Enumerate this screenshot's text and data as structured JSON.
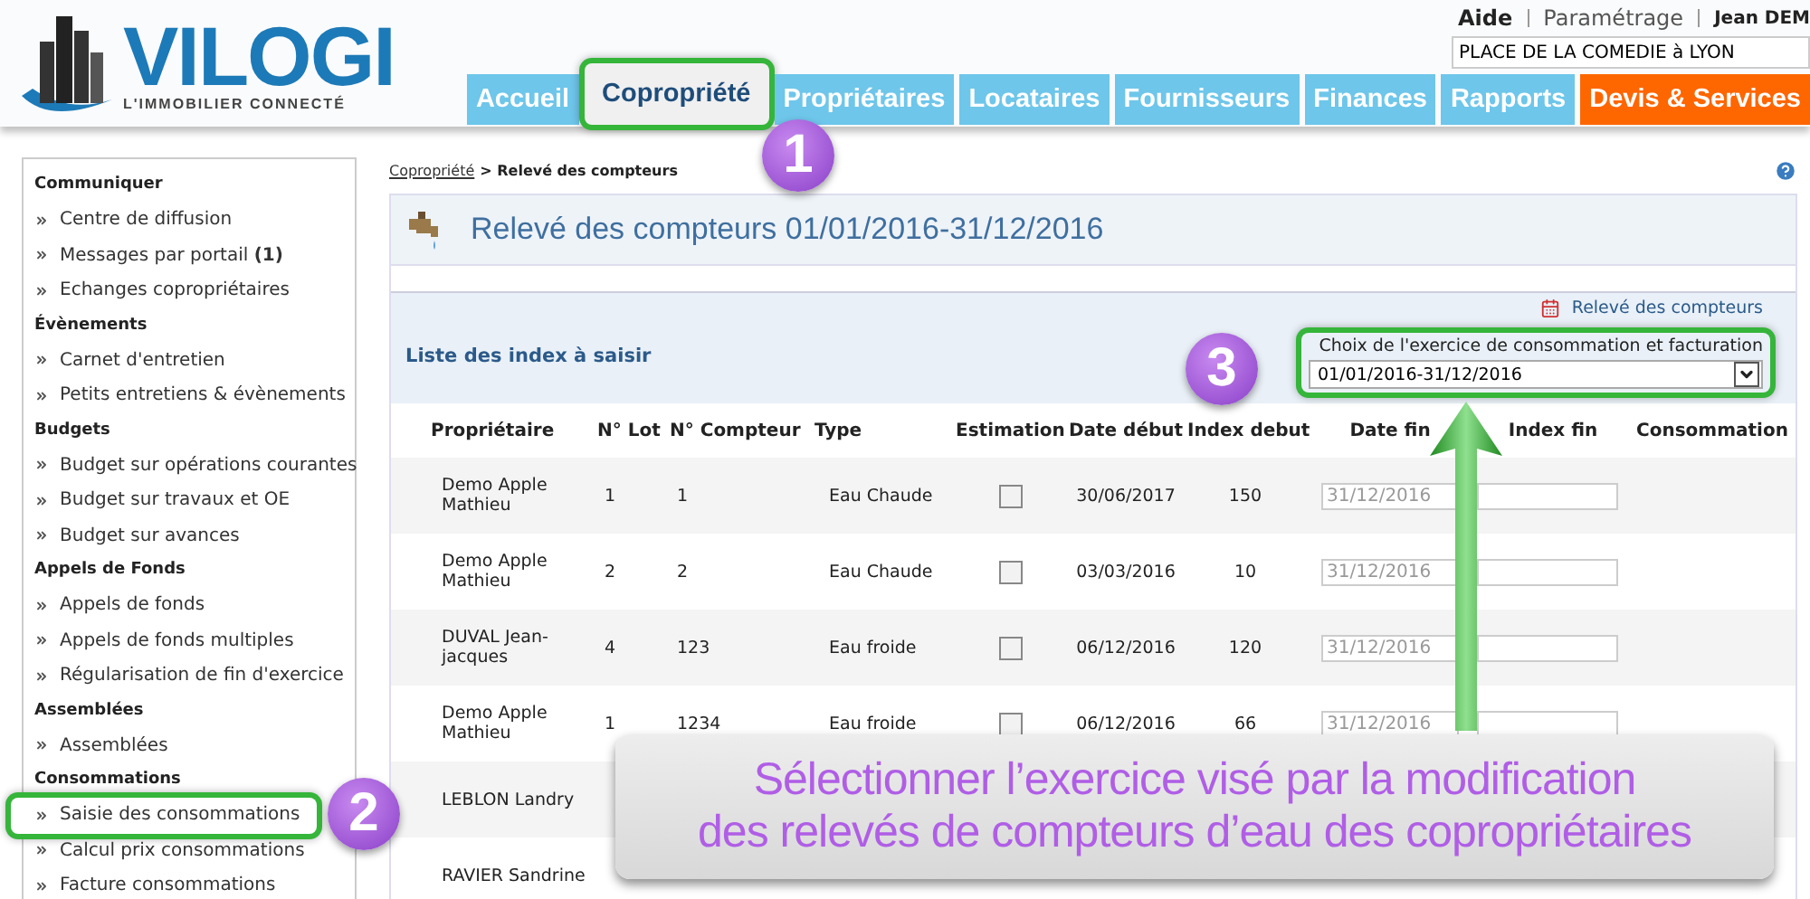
{
  "header": {
    "logo": {
      "name": "VILOGI",
      "tagline": "L'IMMOBILIER CONNECTÉ"
    },
    "top_links": [
      "Aide",
      "Paramétrage",
      "Jean DEM"
    ],
    "location_field": {
      "value": "PLACE DE LA COMEDIE à LYON"
    },
    "nav_tabs": [
      {
        "label": "Accueil",
        "selected": false,
        "highlighted": false,
        "kind": "normal"
      },
      {
        "label": "Copropriété",
        "selected": true,
        "highlighted": true,
        "kind": "normal"
      },
      {
        "label": "Propriétaires",
        "selected": false,
        "highlighted": false,
        "kind": "normal"
      },
      {
        "label": "Locataires",
        "selected": false,
        "highlighted": false,
        "kind": "normal"
      },
      {
        "label": "Fournisseurs",
        "selected": false,
        "highlighted": false,
        "kind": "normal"
      },
      {
        "label": "Finances",
        "selected": false,
        "highlighted": false,
        "kind": "normal"
      },
      {
        "label": "Rapports",
        "selected": false,
        "highlighted": false,
        "kind": "normal"
      },
      {
        "label": "Devis & Services",
        "selected": false,
        "highlighted": false,
        "kind": "accent"
      }
    ]
  },
  "sidebar": {
    "sections": [
      {
        "title": "Communiquer",
        "items": [
          {
            "label": "Centre de diffusion",
            "highlighted": false
          },
          {
            "label": "Messages par portail **(1)**",
            "highlighted": false
          },
          {
            "label": "Echanges copropriétaires",
            "highlighted": false
          }
        ]
      },
      {
        "title": "Évènements",
        "items": [
          {
            "label": "Carnet d'entretien",
            "highlighted": false
          },
          {
            "label": "Petits entretiens & évènements",
            "highlighted": false
          }
        ]
      },
      {
        "title": "Budgets",
        "items": [
          {
            "label": "Budget sur opérations courantes",
            "highlighted": false
          },
          {
            "label": "Budget sur travaux et OE",
            "highlighted": false
          },
          {
            "label": "Budget sur avances",
            "highlighted": false
          }
        ]
      },
      {
        "title": "Appels de Fonds",
        "items": [
          {
            "label": "Appels de fonds",
            "highlighted": false
          },
          {
            "label": "Appels de fonds multiples",
            "highlighted": false
          },
          {
            "label": "Régularisation de fin d'exercice",
            "highlighted": false
          }
        ]
      },
      {
        "title": "Assemblées",
        "items": [
          {
            "label": "Assemblées",
            "highlighted": false
          }
        ]
      },
      {
        "title": "Consommations",
        "items": [
          {
            "label": "Saisie des consommations",
            "highlighted": true
          },
          {
            "label": "Calcul prix consommations",
            "highlighted": false
          },
          {
            "label": "Facture consommations",
            "highlighted": false
          }
        ]
      }
    ]
  },
  "breadcrumb": {
    "link": "Copropriété",
    "current": "> Relevé des compteurs"
  },
  "page_title": "Relevé des compteurs 01/01/2016-31/12/2016",
  "panel": {
    "link": "Relevé des compteurs",
    "title": "Liste des index à saisir",
    "exercise_select": {
      "label": "Choix de l'exercice de consommation et facturation",
      "value": "01/01/2016-31/12/2016",
      "highlighted": true
    }
  },
  "table": {
    "columns": [
      "Propriétaire",
      "N° Lot",
      "N° Compteur",
      "Type",
      "Estimation",
      "Date début",
      "Index debut",
      "Date fin",
      "Index fin",
      "Consommation"
    ],
    "rows": [
      {
        "owner": "Demo Apple Mathieu",
        "lot": "1",
        "meter": "1",
        "type": "Eau Chaude",
        "estimation": false,
        "start_date": "30/06/2017",
        "start_index": "150",
        "end_date": "31/12/2016"
      },
      {
        "owner": "Demo Apple Mathieu",
        "lot": "2",
        "meter": "2",
        "type": "Eau Chaude",
        "estimation": false,
        "start_date": "03/03/2016",
        "start_index": "10",
        "end_date": "31/12/2016"
      },
      {
        "owner": "DUVAL Jean-jacques",
        "lot": "4",
        "meter": "123",
        "type": "Eau froide",
        "estimation": false,
        "start_date": "06/12/2016",
        "start_index": "120",
        "end_date": "31/12/2016"
      },
      {
        "owner": "Demo Apple Mathieu",
        "lot": "1",
        "meter": "1234",
        "type": "Eau froide",
        "estimation": false,
        "start_date": "06/12/2016",
        "start_index": "66",
        "end_date": "31/12/2016"
      },
      {
        "owner": "LEBLON Landry"
      },
      {
        "owner": "RAVIER Sandrine"
      }
    ]
  },
  "annotations": {
    "steps": [
      "1",
      "2",
      "3"
    ],
    "callout": [
      "Sélectionner l’exercice visé par la modification",
      "des relevés de compteurs d’eau des copropriétaires"
    ]
  }
}
